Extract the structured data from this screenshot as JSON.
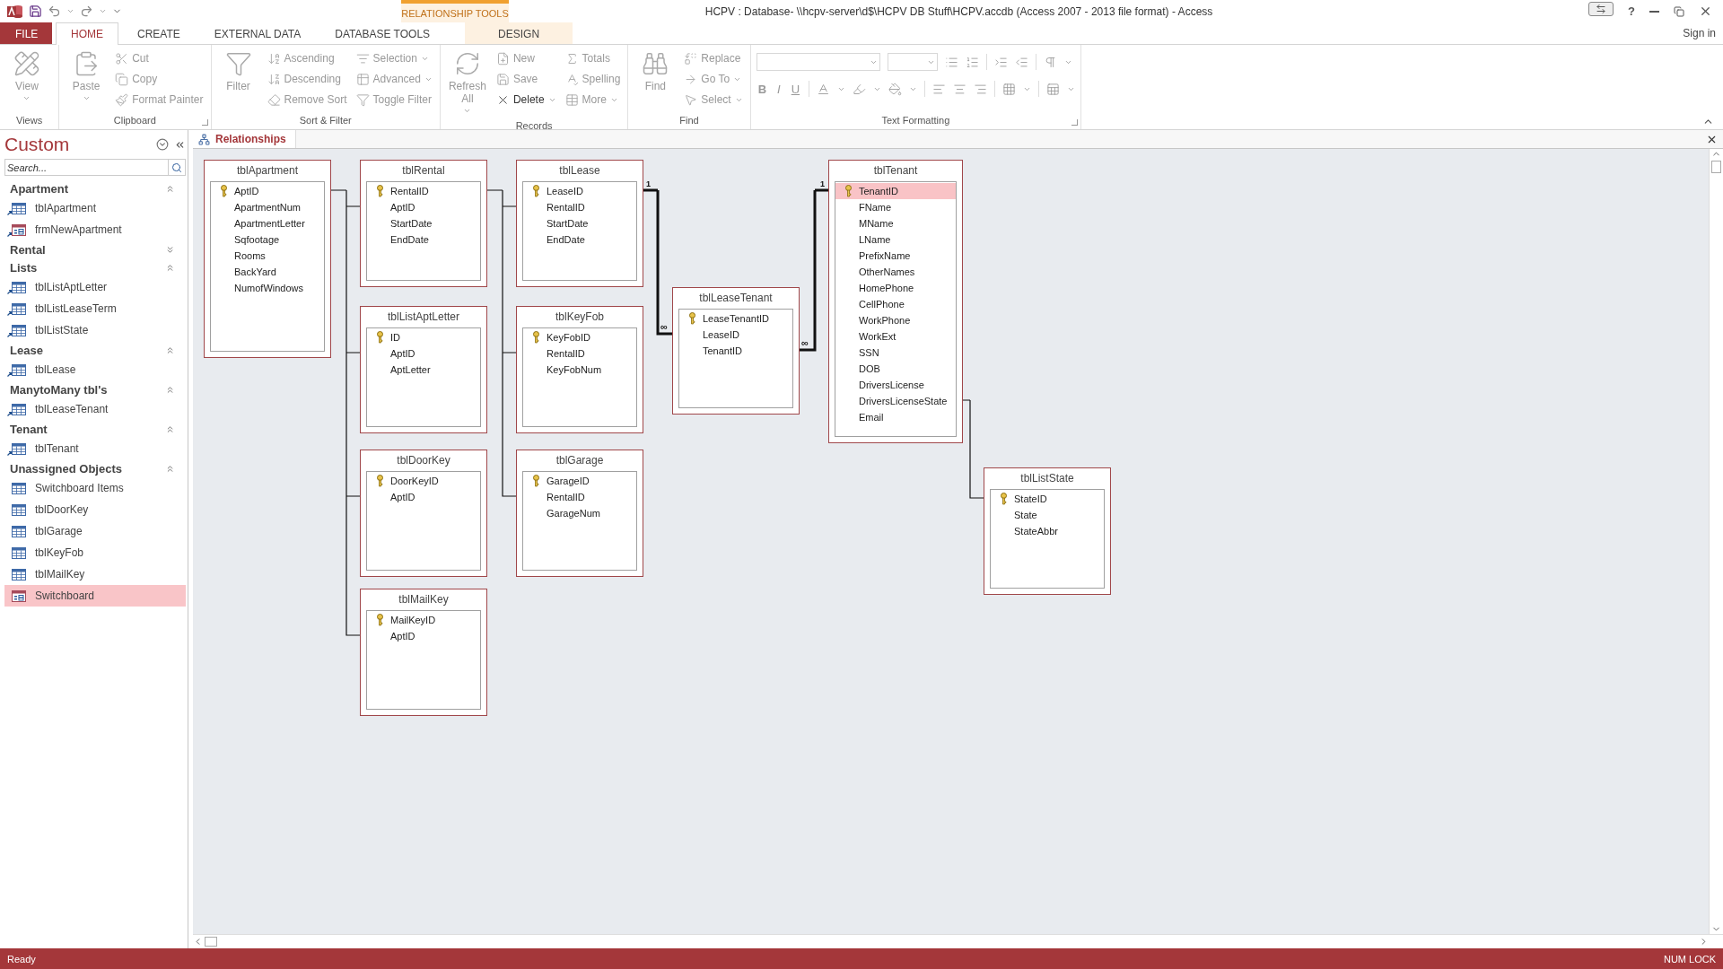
{
  "title_bar": {
    "title": "HCPV : Database- \\\\hcpv-server\\d$\\HCPV DB Stuff\\HCPV.accdb (Access 2007 - 2013 file format) - Access",
    "context_label": "RELATIONSHIP TOOLS",
    "help": "?",
    "sign_in": "Sign in"
  },
  "tabs": [
    {
      "label": "FILE",
      "kind": "file",
      "selected": false
    },
    {
      "label": "HOME",
      "kind": "tab",
      "selected": true
    },
    {
      "label": "CREATE",
      "kind": "tab",
      "selected": false
    },
    {
      "label": "EXTERNAL DATA",
      "kind": "tab",
      "selected": false
    },
    {
      "label": "DATABASE TOOLS",
      "kind": "tab",
      "selected": false
    },
    {
      "label": "DESIGN",
      "kind": "context",
      "selected": false
    }
  ],
  "ribbon": {
    "groups": [
      {
        "label": "Views",
        "kind": "buttons",
        "launcher": false,
        "buttons": [
          {
            "kind": "large",
            "label": "View",
            "dropdown": true,
            "disabled": true
          }
        ]
      },
      {
        "label": "Clipboard",
        "kind": "buttons",
        "launcher": true,
        "buttons": [
          {
            "kind": "large",
            "label": "Paste",
            "dropdown": true,
            "disabled": true
          },
          {
            "kind": "small",
            "label": "Cut",
            "dropdown": false,
            "disabled": true
          },
          {
            "kind": "small",
            "label": "Copy",
            "dropdown": false,
            "disabled": true
          },
          {
            "kind": "small",
            "label": "Format Painter",
            "dropdown": false,
            "disabled": true
          }
        ]
      },
      {
        "label": "Sort & Filter",
        "kind": "buttons",
        "launcher": false,
        "buttons": [
          {
            "kind": "large",
            "label": "Filter",
            "dropdown": false,
            "disabled": true
          },
          {
            "kind": "small",
            "label": "Ascending",
            "dropdown": false,
            "disabled": true
          },
          {
            "kind": "small",
            "label": "Descending",
            "dropdown": false,
            "disabled": true
          },
          {
            "kind": "small",
            "label": "Remove Sort",
            "dropdown": false,
            "disabled": true
          },
          {
            "kind": "small",
            "label": "Selection",
            "dropdown": true,
            "disabled": true
          },
          {
            "kind": "small",
            "label": "Advanced",
            "dropdown": true,
            "disabled": true
          },
          {
            "kind": "small",
            "label": "Toggle Filter",
            "dropdown": false,
            "disabled": true
          }
        ]
      },
      {
        "label": "Records",
        "kind": "buttons",
        "launcher": false,
        "buttons": [
          {
            "kind": "large",
            "label": "Refresh All",
            "dropdown": true,
            "disabled": true
          },
          {
            "kind": "small",
            "label": "New",
            "dropdown": false,
            "disabled": true
          },
          {
            "kind": "small",
            "label": "Save",
            "dropdown": false,
            "disabled": true
          },
          {
            "kind": "small",
            "label": "Delete",
            "dropdown": true,
            "disabled": false
          },
          {
            "kind": "small",
            "label": "Totals",
            "dropdown": false,
            "disabled": true
          },
          {
            "kind": "small",
            "label": "Spelling",
            "dropdown": false,
            "disabled": true
          },
          {
            "kind": "small",
            "label": "More",
            "dropdown": true,
            "disabled": true
          }
        ]
      },
      {
        "label": "Find",
        "kind": "buttons",
        "launcher": false,
        "buttons": [
          {
            "kind": "large",
            "label": "Find",
            "dropdown": false,
            "disabled": true
          },
          {
            "kind": "small",
            "label": "Replace",
            "dropdown": false,
            "disabled": true
          },
          {
            "kind": "small",
            "label": "Go To",
            "dropdown": true,
            "disabled": true
          },
          {
            "kind": "small",
            "label": "Select",
            "dropdown": true,
            "disabled": true
          }
        ]
      },
      {
        "label": "Text Formatting",
        "kind": "formatting",
        "launcher": true,
        "format_buttons": [
          {
            "label": "B"
          },
          {
            "label": "I"
          },
          {
            "label": "U"
          }
        ]
      }
    ]
  },
  "nav_pane": {
    "title": "Custom",
    "search": {
      "placeholder": "Search..."
    },
    "groups": [
      {
        "label": "Apartment",
        "expanded": true,
        "items": [
          {
            "label": "tblApartment",
            "kind": "table",
            "shortcut": true,
            "selected": false
          },
          {
            "label": "frmNewApartment",
            "kind": "form",
            "shortcut": true,
            "selected": false
          }
        ]
      },
      {
        "label": "Rental",
        "expanded": false
      },
      {
        "label": "Lists",
        "expanded": true,
        "items": [
          {
            "label": "tblListAptLetter",
            "kind": "table",
            "shortcut": true,
            "selected": false
          },
          {
            "label": "tblListLeaseTerm",
            "kind": "table",
            "shortcut": true,
            "selected": false
          },
          {
            "label": "tblListState",
            "kind": "table",
            "shortcut": true,
            "selected": false
          }
        ]
      },
      {
        "label": "Lease",
        "expanded": true,
        "items": [
          {
            "label": "tblLease",
            "kind": "table",
            "shortcut": true,
            "selected": false
          }
        ]
      },
      {
        "label": "ManytoMany tbl's",
        "expanded": true,
        "items": [
          {
            "label": "tblLeaseTenant",
            "kind": "table",
            "shortcut": true,
            "selected": false
          }
        ]
      },
      {
        "label": "Tenant",
        "expanded": true,
        "items": [
          {
            "label": "tblTenant",
            "kind": "table",
            "shortcut": true,
            "selected": false
          }
        ]
      },
      {
        "label": "Unassigned Objects",
        "expanded": true,
        "items": [
          {
            "label": "Switchboard Items",
            "kind": "table",
            "shortcut": false,
            "selected": false
          },
          {
            "label": "tblDoorKey",
            "kind": "table",
            "shortcut": false,
            "selected": false
          },
          {
            "label": "tblGarage",
            "kind": "table",
            "shortcut": false,
            "selected": false
          },
          {
            "label": "tblKeyFob",
            "kind": "table",
            "shortcut": false,
            "selected": false
          },
          {
            "label": "tblMailKey",
            "kind": "table",
            "shortcut": false,
            "selected": false
          },
          {
            "label": "Switchboard",
            "kind": "form",
            "shortcut": false,
            "selected": true
          }
        ]
      }
    ]
  },
  "document_tabs": [
    {
      "label": "Relationships",
      "selected": true
    }
  ],
  "tables": [
    {
      "name": "tblApartment",
      "fields": [
        {
          "name": "AptID",
          "key": true,
          "selected": false
        },
        {
          "name": "ApartmentNum",
          "key": false,
          "selected": false
        },
        {
          "name": "ApartmentLetter",
          "key": false,
          "selected": false
        },
        {
          "name": "Sqfootage",
          "key": false,
          "selected": false
        },
        {
          "name": "Rooms",
          "key": false,
          "selected": false
        },
        {
          "name": "BackYard",
          "key": false,
          "selected": false
        },
        {
          "name": "NumofWindows",
          "key": false,
          "selected": false
        }
      ]
    },
    {
      "name": "tblRental",
      "fields": [
        {
          "name": "RentalID",
          "key": true,
          "selected": false
        },
        {
          "name": "AptID",
          "key": false,
          "selected": false
        },
        {
          "name": "StartDate",
          "key": false,
          "selected": false
        },
        {
          "name": "EndDate",
          "key": false,
          "selected": false
        }
      ]
    },
    {
      "name": "tblLease",
      "fields": [
        {
          "name": "LeaseID",
          "key": true,
          "selected": false
        },
        {
          "name": "RentalID",
          "key": false,
          "selected": false
        },
        {
          "name": "StartDate",
          "key": false,
          "selected": false
        },
        {
          "name": "EndDate",
          "key": false,
          "selected": false
        }
      ]
    },
    {
      "name": "tblListAptLetter",
      "fields": [
        {
          "name": "ID",
          "key": true,
          "selected": false
        },
        {
          "name": "AptID",
          "key": false,
          "selected": false
        },
        {
          "name": "AptLetter",
          "key": false,
          "selected": false
        }
      ]
    },
    {
      "name": "tblKeyFob",
      "fields": [
        {
          "name": "KeyFobID",
          "key": true,
          "selected": false
        },
        {
          "name": "RentalID",
          "key": false,
          "selected": false
        },
        {
          "name": "KeyFobNum",
          "key": false,
          "selected": false
        }
      ]
    },
    {
      "name": "tblDoorKey",
      "fields": [
        {
          "name": "DoorKeyID",
          "key": true,
          "selected": false
        },
        {
          "name": "AptID",
          "key": false,
          "selected": false
        }
      ]
    },
    {
      "name": "tblGarage",
      "fields": [
        {
          "name": "GarageID",
          "key": true,
          "selected": false
        },
        {
          "name": "RentalID",
          "key": false,
          "selected": false
        },
        {
          "name": "GarageNum",
          "key": false,
          "selected": false
        }
      ]
    },
    {
      "name": "tblMailKey",
      "fields": [
        {
          "name": "MailKeyID",
          "key": true,
          "selected": false
        },
        {
          "name": "AptID",
          "key": false,
          "selected": false
        }
      ]
    },
    {
      "name": "tblLeaseTenant",
      "fields": [
        {
          "name": "LeaseTenantID",
          "key": true,
          "selected": false
        },
        {
          "name": "LeaseID",
          "key": false,
          "selected": false
        },
        {
          "name": "TenantID",
          "key": false,
          "selected": false
        }
      ]
    },
    {
      "name": "tblTenant",
      "fields": [
        {
          "name": "TenantID",
          "key": true,
          "selected": true
        },
        {
          "name": "FName",
          "key": false,
          "selected": false
        },
        {
          "name": "MName",
          "key": false,
          "selected": false
        },
        {
          "name": "LName",
          "key": false,
          "selected": false
        },
        {
          "name": "PrefixName",
          "key": false,
          "selected": false
        },
        {
          "name": "OtherNames",
          "key": false,
          "selected": false
        },
        {
          "name": "HomePhone",
          "key": false,
          "selected": false
        },
        {
          "name": "CellPhone",
          "key": false,
          "selected": false
        },
        {
          "name": "WorkPhone",
          "key": false,
          "selected": false
        },
        {
          "name": "WorkExt",
          "key": false,
          "selected": false
        },
        {
          "name": "SSN",
          "key": false,
          "selected": false
        },
        {
          "name": "DOB",
          "key": false,
          "selected": false
        },
        {
          "name": "DriversLicense",
          "key": false,
          "selected": false
        },
        {
          "name": "DriversLicenseState",
          "key": false,
          "selected": false
        },
        {
          "name": "Email",
          "key": false,
          "selected": false
        }
      ]
    },
    {
      "name": "tblListState",
      "fields": [
        {
          "name": "StateID",
          "key": true,
          "selected": false
        },
        {
          "name": "State",
          "key": false,
          "selected": false
        },
        {
          "name": "StateAbbr",
          "key": false,
          "selected": false
        }
      ]
    }
  ],
  "relationships": [
    {
      "enforced": false
    },
    {
      "enforced": false
    },
    {
      "enforced": true,
      "one_label": "1",
      "many_label": "∞"
    },
    {
      "enforced": true,
      "one_label": "1",
      "many_label": "∞"
    },
    {
      "enforced": false
    }
  ],
  "status_bar": {
    "left": "Ready",
    "right": "NUM LOCK"
  }
}
